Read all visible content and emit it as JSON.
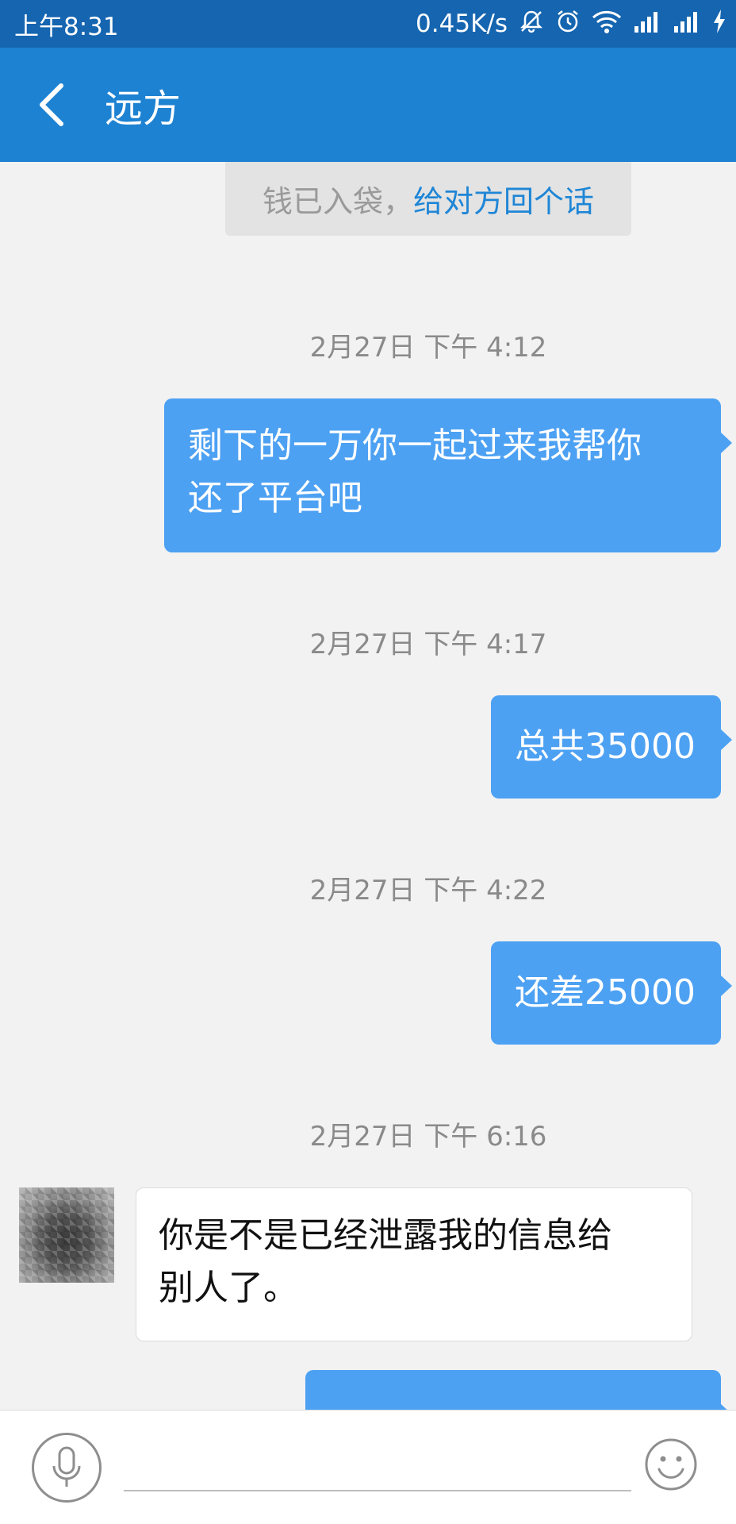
{
  "status_bar": {
    "time": "上午8:31",
    "speed": "0.45K/s",
    "icons": [
      "bell-off-icon",
      "alarm-icon",
      "wifi-icon",
      "signal-icon",
      "signal-icon",
      "charging-icon"
    ]
  },
  "header": {
    "back_icon": "chevron-left-icon",
    "title": "远方"
  },
  "chat": {
    "system_notice": {
      "text": "钱已入袋，",
      "link": "给对方回个话"
    },
    "timestamps": [
      "2月27日 下午 4:12",
      "2月27日 下午 4:17",
      "2月27日 下午 4:22",
      "2月27日 下午 6:16"
    ],
    "messages": [
      {
        "side": "out",
        "lines": [
          "剩下的一万你一起过来我帮你",
          "还了平台吧"
        ]
      },
      {
        "side": "out",
        "lines": [
          "总共35000"
        ]
      },
      {
        "side": "out",
        "lines": [
          "还差25000"
        ]
      },
      {
        "side": "in",
        "lines": [
          "你是不是已经泄露我的信息给",
          "别人了。"
        ]
      }
    ]
  },
  "input_bar": {
    "voice_icon": "microphone-icon",
    "emoji_icon": "smiley-icon",
    "placeholder": ""
  },
  "colors": {
    "status_bar": "#1565b0",
    "title_bar": "#1e82d2",
    "outgoing_bubble": "#4da1f3",
    "link": "#1f86d6",
    "background": "#f2f2f2"
  }
}
